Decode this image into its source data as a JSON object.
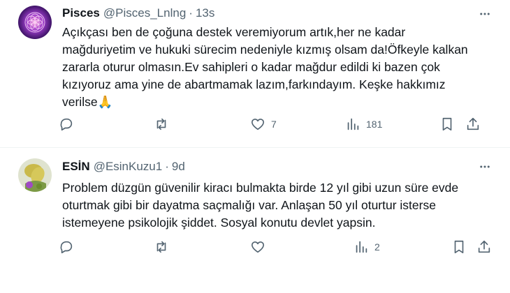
{
  "tweets": [
    {
      "display_name": "Pisces",
      "handle": "@Pisces_Lnlng",
      "separator": "·",
      "time": "13s",
      "text": "Açıkçası ben de çoğuna destek veremiyorum artık,her ne kadar mağduriyetim ve hukuki sürecim nedeniyle kızmış olsam da!Öfkeyle kalkan zararla oturur olmasın.Ev sahipleri o kadar mağdur edildi ki bazen çok kızıyoruz ama yine de abartmamak lazım,farkındayım. Keşke hakkımız verilse🙏",
      "likes": "7",
      "views": "181"
    },
    {
      "display_name": "ESİN",
      "handle": "@EsinKuzu1",
      "separator": "·",
      "time": "9d",
      "text": "Problem düzgün güvenilir kiracı bulmakta birde 12 yıl gibi uzun süre evde oturtmak gibi bir dayatma saçmalığı var. Anlaşan 50 yıl oturtur isterse istemeyene psikolojik şiddet. Sosyal konutu devlet yapsin.",
      "likes": "",
      "views": "2"
    }
  ],
  "colors": {
    "text": "#0f1419",
    "secondary": "#536471",
    "divider": "#eff3f4"
  },
  "icons": [
    "more-icon",
    "reply-icon",
    "repost-icon",
    "like-icon",
    "views-icon",
    "bookmark-icon",
    "share-icon"
  ]
}
